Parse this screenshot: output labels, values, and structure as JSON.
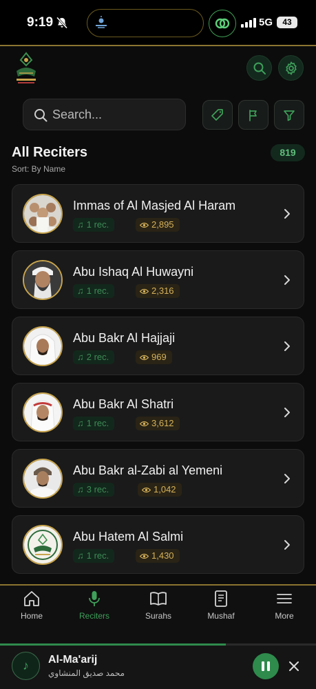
{
  "status_bar": {
    "time": "9:19",
    "network": "5G",
    "battery": "43"
  },
  "header": {
    "logo_icon": "app-logo-icon",
    "search_icon": "search-icon",
    "settings_icon": "gear-icon"
  },
  "search": {
    "placeholder": "Search..."
  },
  "filters": [
    {
      "name": "tag-filter-button",
      "icon": "tag-icon"
    },
    {
      "name": "flag-filter-button",
      "icon": "flag-icon"
    },
    {
      "name": "funnel-filter-button",
      "icon": "filter-icon"
    }
  ],
  "section": {
    "title": "All Reciters",
    "sort": "Sort: By Name",
    "count": "819"
  },
  "reciters": [
    {
      "name": "Immas of Al Masjed Al Haram",
      "recordings": "1 rec.",
      "views": "2,895"
    },
    {
      "name": "Abu Ishaq Al Huwayni",
      "recordings": "1 rec.",
      "views": "2,316"
    },
    {
      "name": "Abu Bakr Al Hajjaji",
      "recordings": "2 rec.",
      "views": "969"
    },
    {
      "name": "Abu Bakr Al Shatri",
      "recordings": "1 rec.",
      "views": "3,612"
    },
    {
      "name": "Abu Bakr al-Zabi al Yemeni",
      "recordings": "3 rec.",
      "views": "1,042"
    },
    {
      "name": "Abu Hatem Al Salmi",
      "recordings": "1 rec.",
      "views": "1,430"
    }
  ],
  "nav": {
    "home": "Home",
    "reciters": "Reciters",
    "surahs": "Surahs",
    "mushaf": "Mushaf",
    "more": "More"
  },
  "player": {
    "title": "Al-Ma'arij",
    "subtitle": "محمد صديق المنشاوي",
    "progress": 0.715
  },
  "colors": {
    "accent": "#2e8b4c",
    "gold": "#c9a54d",
    "background": "#0c0c0c",
    "card": "#1a1a1a"
  }
}
